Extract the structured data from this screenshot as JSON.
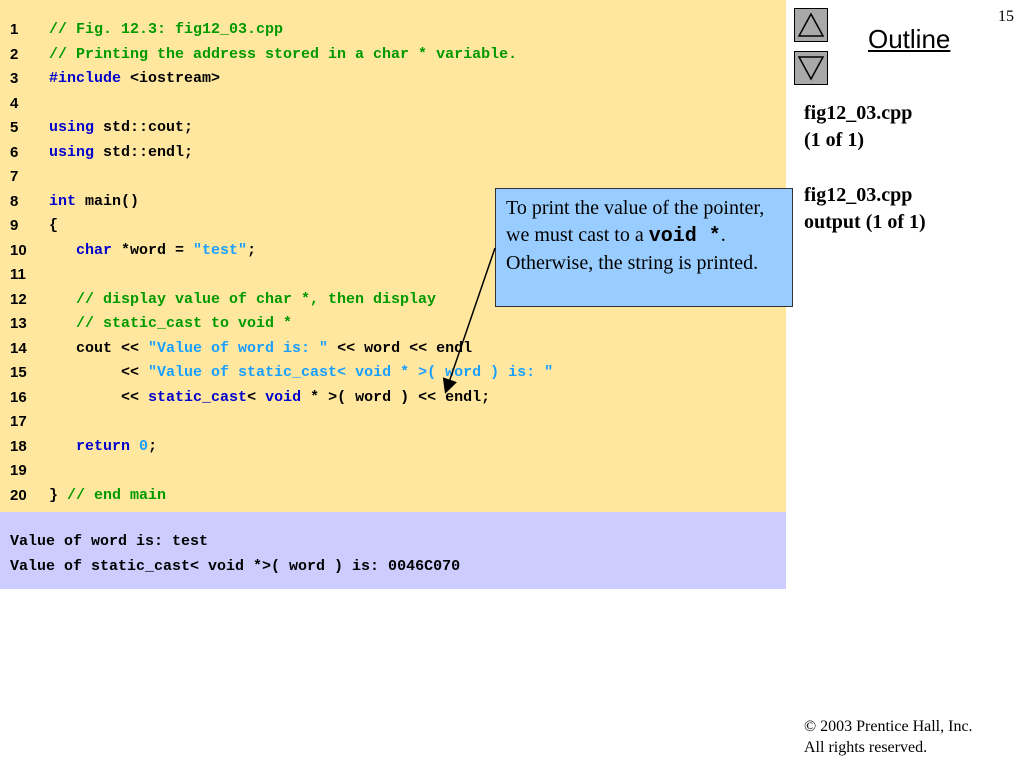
{
  "page_number": "15",
  "outline": {
    "title": "Outline",
    "up_icon": "up-triangle-icon",
    "down_icon": "down-triangle-icon"
  },
  "side_notes": [
    [
      "fig12_03.cpp",
      "(1 of 1)"
    ],
    [
      "fig12_03.cpp",
      "output (1 of 1)"
    ]
  ],
  "code_lines": [
    {
      "n": "1",
      "parts": [
        {
          "t": "// Fig. 12.3: fig12_03.cpp",
          "c": "cm"
        }
      ]
    },
    {
      "n": "2",
      "parts": [
        {
          "t": "// Printing the address stored in a char * variable.",
          "c": "cm"
        }
      ]
    },
    {
      "n": "3",
      "parts": [
        {
          "t": "#include",
          "c": "kw"
        },
        {
          "t": " <iostream>",
          "c": "pl"
        }
      ]
    },
    {
      "n": "4",
      "parts": []
    },
    {
      "n": "5",
      "parts": [
        {
          "t": "using",
          "c": "kw"
        },
        {
          "t": " std::cout;",
          "c": "pl"
        }
      ]
    },
    {
      "n": "6",
      "parts": [
        {
          "t": "using",
          "c": "kw"
        },
        {
          "t": " std::endl;",
          "c": "pl"
        }
      ]
    },
    {
      "n": "7",
      "parts": []
    },
    {
      "n": "8",
      "parts": [
        {
          "t": "int",
          "c": "kw"
        },
        {
          "t": " main()",
          "c": "pl"
        }
      ]
    },
    {
      "n": "9",
      "parts": [
        {
          "t": "{",
          "c": "pl"
        }
      ]
    },
    {
      "n": "10",
      "parts": [
        {
          "t": "   ",
          "c": "pl"
        },
        {
          "t": "char",
          "c": "kw"
        },
        {
          "t": " *word = ",
          "c": "pl"
        },
        {
          "t": "\"test\"",
          "c": "st"
        },
        {
          "t": ";",
          "c": "pl"
        }
      ]
    },
    {
      "n": "11",
      "parts": []
    },
    {
      "n": "12",
      "parts": [
        {
          "t": "   // display value of char *, then display",
          "c": "cm"
        }
      ]
    },
    {
      "n": "13",
      "parts": [
        {
          "t": "   // static_cast to void *",
          "c": "cm"
        }
      ]
    },
    {
      "n": "14",
      "parts": [
        {
          "t": "   cout << ",
          "c": "pl"
        },
        {
          "t": "\"Value of word is: \"",
          "c": "st"
        },
        {
          "t": " << word << endl",
          "c": "pl"
        }
      ]
    },
    {
      "n": "15",
      "parts": [
        {
          "t": "        << ",
          "c": "pl"
        },
        {
          "t": "\"Value of static_cast< void * >( word ) is: \"",
          "c": "st"
        }
      ]
    },
    {
      "n": "16",
      "parts": [
        {
          "t": "        << ",
          "c": "pl"
        },
        {
          "t": "static_cast",
          "c": "kw"
        },
        {
          "t": "< ",
          "c": "pl"
        },
        {
          "t": "void",
          "c": "kw"
        },
        {
          "t": " * >( word ) << endl;",
          "c": "pl"
        }
      ]
    },
    {
      "n": "17",
      "parts": []
    },
    {
      "n": "18",
      "parts": [
        {
          "t": "   ",
          "c": "pl"
        },
        {
          "t": "return",
          "c": "kw"
        },
        {
          "t": " ",
          "c": "pl"
        },
        {
          "t": "0",
          "c": "nm"
        },
        {
          "t": ";",
          "c": "pl"
        }
      ]
    },
    {
      "n": "19",
      "parts": []
    },
    {
      "n": "20",
      "parts": [
        {
          "t": "} ",
          "c": "pl"
        },
        {
          "t": "// end main",
          "c": "cm"
        }
      ]
    }
  ],
  "output_lines": [
    "Value of word is: test",
    "Value of static_cast< void *>( word ) is: 0046C070"
  ],
  "callout": {
    "text_before": "To print the value of the pointer, we must cast to a ",
    "code": "void *",
    "text_after": ". Otherwise, the string is printed."
  },
  "copyright": {
    "symbol": "©",
    "line1": " 2003 Prentice Hall, Inc.",
    "line2": "All rights reserved."
  }
}
